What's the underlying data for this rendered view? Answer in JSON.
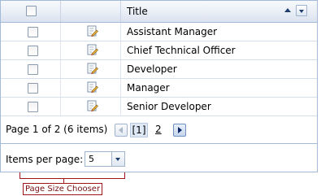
{
  "grid": {
    "header": {
      "title": "Title"
    },
    "rows": [
      {
        "title": "Assistant Manager"
      },
      {
        "title": "Chief Technical Officer"
      },
      {
        "title": "Developer"
      },
      {
        "title": "Manager"
      },
      {
        "title": "Senior Developer"
      }
    ]
  },
  "pager": {
    "info": "Page 1 of 2 (6 items)",
    "current_page": "[1]",
    "next_page": "2"
  },
  "page_size": {
    "label": "Items per page:",
    "value": "5"
  },
  "callout": {
    "label": "Page Size Chooser"
  },
  "colors": {
    "border": "#a3bad9",
    "callout": "#a0151a"
  },
  "icons": {
    "edit": "edit-pencil-icon",
    "sort": "sort-ascending-icon"
  }
}
